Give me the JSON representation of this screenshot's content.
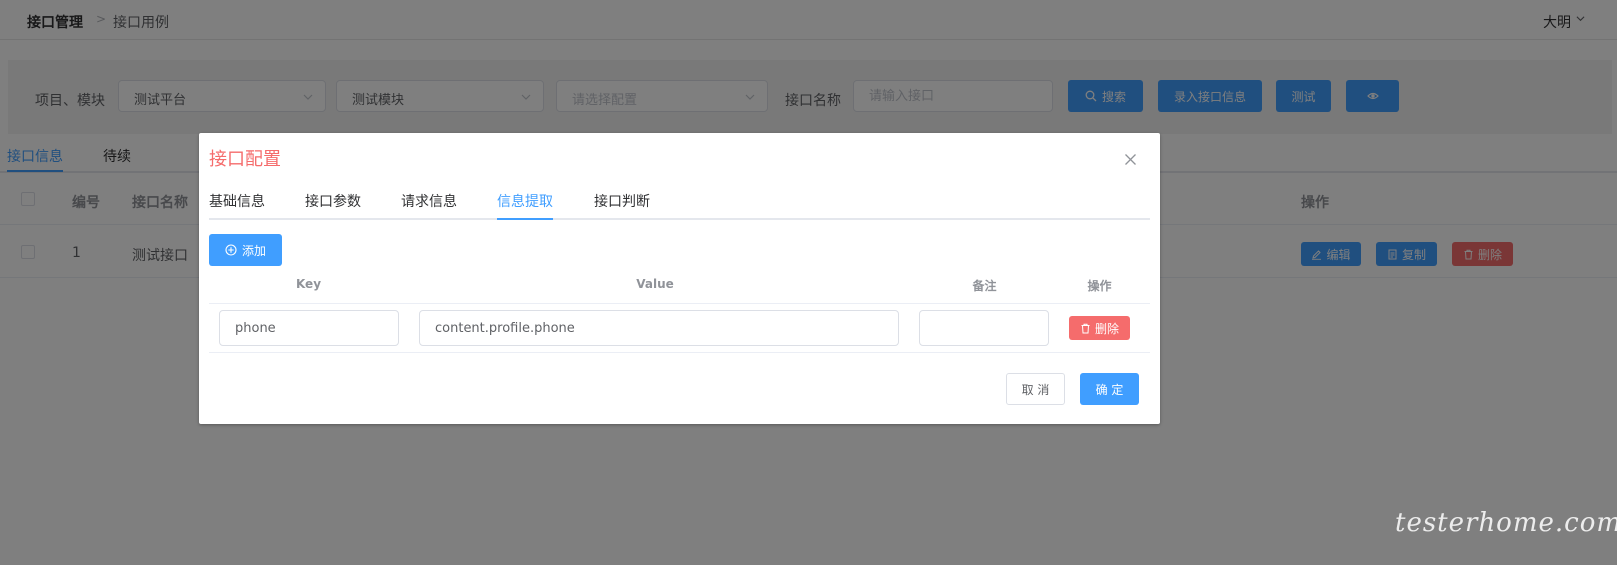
{
  "breadcrumb": {
    "parent": "接口管理",
    "separator": ">",
    "current": "接口用例"
  },
  "user": {
    "name": "大明"
  },
  "filters": {
    "project_label": "项目、模块",
    "project_select": "测试平台",
    "module_select": "测试模块",
    "config_placeholder": "请选择配置",
    "interface_label": "接口名称",
    "interface_placeholder": "请输入接口",
    "search_label": "搜索",
    "add_interface_label": "录入接口信息",
    "test_label": "测试"
  },
  "page_tabs": [
    {
      "label": "接口信息",
      "active": true
    },
    {
      "label": "待续",
      "active": false
    }
  ],
  "table": {
    "headers": {
      "number": "编号",
      "name": "接口名称",
      "actions": "操作"
    },
    "rows": [
      {
        "number": "1",
        "name": "测试接口",
        "edit": "编辑",
        "copy": "复制",
        "delete": "删除"
      }
    ]
  },
  "dialog": {
    "title": "接口配置",
    "tabs": [
      {
        "label": "基础信息",
        "active": false
      },
      {
        "label": "接口参数",
        "active": false
      },
      {
        "label": "请求信息",
        "active": false
      },
      {
        "label": "信息提取",
        "active": true
      },
      {
        "label": "接口判断",
        "active": false
      }
    ],
    "add_label": "添加",
    "columns": {
      "key": "Key",
      "value": "Value",
      "note": "备注",
      "actions": "操作"
    },
    "rows": [
      {
        "key": "phone",
        "value": "content.profile.phone",
        "note": "",
        "delete": "删除"
      }
    ],
    "cancel_label": "取 消",
    "confirm_label": "确 定"
  },
  "watermark": "testerhome.com",
  "colors": {
    "primary": "#409eff",
    "danger": "#f56c6c",
    "title_red": "#f56c6c"
  }
}
